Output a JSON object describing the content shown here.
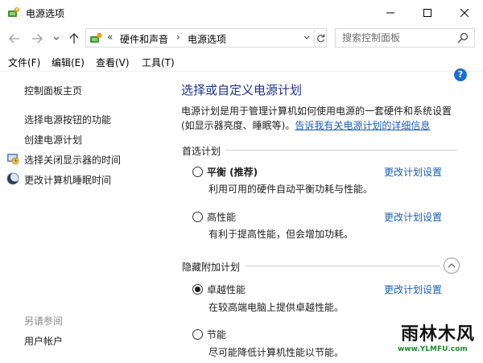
{
  "window": {
    "title": "电源选项",
    "icon": "power-options-icon",
    "controls": [
      "minimize-icon",
      "maximize-icon",
      "close-icon"
    ]
  },
  "address": {
    "crumb_overflow": "«",
    "crumbs": [
      "硬件和声音",
      "电源选项"
    ],
    "crumb_separator": "›",
    "search_placeholder": "搜索控制面板"
  },
  "menu": [
    "文件(F)",
    "编辑(E)",
    "查看(V)",
    "工具(T)"
  ],
  "sidebar": {
    "home": "控制面板主页",
    "links": [
      {
        "label": "选择电源按钮的功能",
        "icon": ""
      },
      {
        "label": "创建电源计划",
        "icon": ""
      },
      {
        "label": "选择关闭显示器的时间",
        "icon": "display-clock-icon"
      },
      {
        "label": "更改计算机睡眠时间",
        "icon": "moon-icon"
      }
    ],
    "see_also_heading": "另请参阅",
    "see_also_links": [
      "用户帐户"
    ]
  },
  "main": {
    "help": "?",
    "title": "选择或自定义电源计划",
    "description_line1": "电源计划是用于管理计算机如何使用电源的一套硬件和系统设置",
    "description_line2_prefix": "(如显示器亮度、睡眠等)。",
    "description_link": "告诉我有关电源计划的详细信息",
    "preferred_heading": "首选计划",
    "hidden_heading": "隐藏附加计划",
    "change_settings_label": "更改计划设置",
    "plans": [
      {
        "name": "平衡 (推荐)",
        "description": "利用可用的硬件自动平衡功耗与性能。",
        "selected": false,
        "bold": true
      },
      {
        "name": "高性能",
        "description": "有利于提高性能，但会增加功耗。",
        "selected": false,
        "bold": false
      },
      {
        "name": "卓越性能",
        "description": "在较高端电脑上提供卓越性能。",
        "selected": true,
        "bold": false
      },
      {
        "name": "节能",
        "description": "尽可能降低计算机性能以节能。",
        "selected": false,
        "bold": false
      }
    ]
  },
  "watermark": {
    "text": "雨林木风",
    "url": "www.YLMFU.com"
  },
  "colors": {
    "title_blue": "#1e3287",
    "link_blue": "#1a5fb4",
    "help_blue": "#1c6dd0"
  }
}
